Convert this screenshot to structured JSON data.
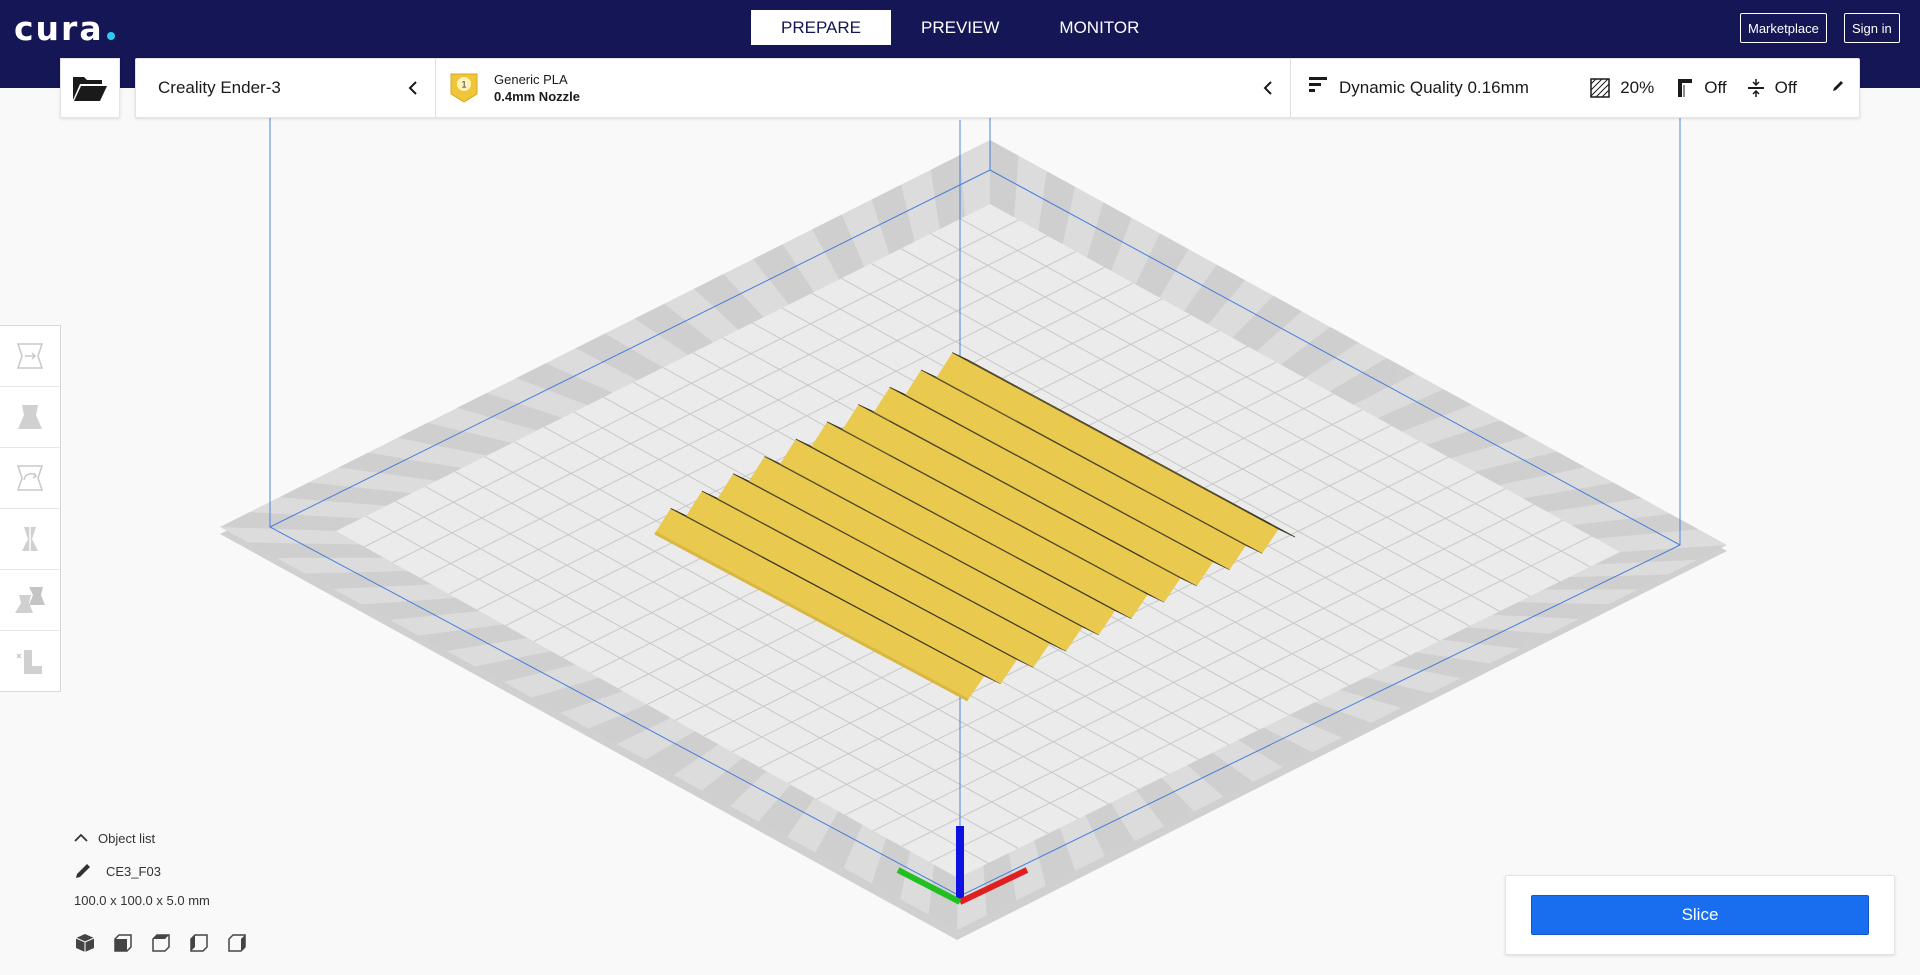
{
  "header": {
    "logo_text": "cura",
    "stages": [
      {
        "label": "PREPARE",
        "active": true
      },
      {
        "label": "PREVIEW",
        "active": false
      },
      {
        "label": "MONITOR",
        "active": false
      }
    ],
    "marketplace_label": "Marketplace",
    "signin_label": "Sign in"
  },
  "toolbar": {
    "open_icon": "folder-open-icon",
    "printer_name": "Creality Ender-3",
    "extruder_number": "1",
    "material_name": "Generic PLA",
    "nozzle": "0.4mm Nozzle",
    "profile": "Dynamic Quality 0.16mm",
    "infill": "20%",
    "support": "Off",
    "adhesion": "Off"
  },
  "tools": [
    "move-tool-icon",
    "scale-tool-icon",
    "rotate-tool-icon",
    "mirror-tool-icon",
    "per-model-settings-icon",
    "support-blocker-icon"
  ],
  "object_list": {
    "header": "Object list",
    "items": [
      {
        "name": "CE3_F03"
      }
    ],
    "dimensions": "100.0 x 100.0 x 5.0 mm",
    "view_buttons": [
      "3d-view-icon",
      "front-view-icon",
      "top-view-icon",
      "left-view-icon",
      "right-view-icon"
    ]
  },
  "slice": {
    "label": "Slice"
  },
  "colors": {
    "header_bg": "#141655",
    "accent_blue": "#196ef0",
    "model_yellow": "#ffe56e",
    "logo_dot": "#2ec9ee"
  }
}
